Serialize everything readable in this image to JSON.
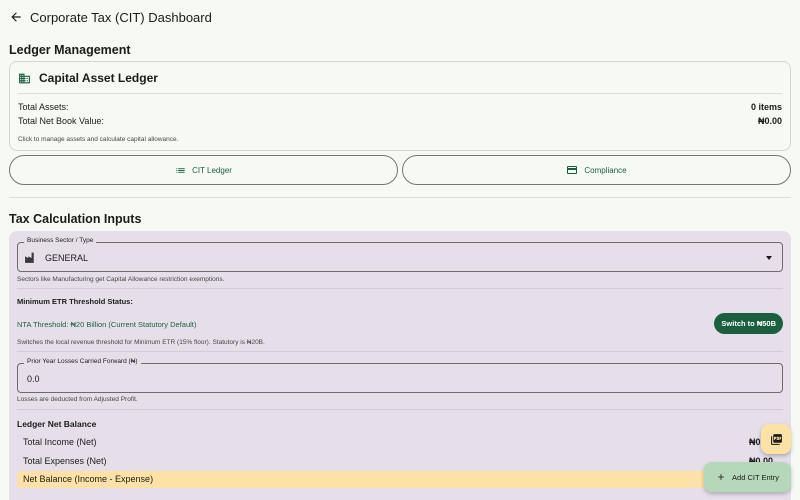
{
  "app": {
    "title": "Corporate Tax (CIT) Dashboard"
  },
  "ledger_management": {
    "heading": "Ledger Management",
    "card": {
      "title": "Capital Asset Ledger",
      "total_assets_label": "Total Assets:",
      "total_assets_value": "0 items",
      "nbv_label": "Total Net Book Value:",
      "nbv_value": "₦0.00",
      "hint": "Click to manage assets and calculate capital allowance."
    },
    "buttons": {
      "cit_ledger": "CIT Ledger",
      "compliance": "Compliance"
    }
  },
  "inputs": {
    "heading": "Tax Calculation Inputs",
    "sector": {
      "label": "Business Sector / Type",
      "value": "GENERAL",
      "hint": "Sectors like Manufacturing get Capital Allowance restriction exemptions."
    },
    "etr": {
      "label": "Minimum ETR Threshold Status:",
      "status": "NTA Threshold: ₦20 Billion (Current Statutory Default)",
      "switch_label": "Switch to ₦50B",
      "hint": "Switches the local revenue threshold for Minimum ETR (15% floor). Statutory is ₦20B."
    },
    "losses": {
      "label": "Prior Year Losses Carried Forward (₦)",
      "value": "0.0",
      "hint": "Losses are deducted from Adjusted Profit."
    },
    "balance": {
      "heading": "Ledger Net Balance",
      "income_label": "Total Income (Net)",
      "income_value": "₦0",
      "expenses_label": "Total Expenses (Net)",
      "expenses_value": "₦0.00",
      "net_label": "Net Balance (Income - Expense)"
    }
  },
  "fab": {
    "label": "Add CIT Entry"
  },
  "colors": {
    "primary": "#1c5f3e",
    "panel": "#e6dfea",
    "highlight": "#fde2a8",
    "fab": "#b5d8bb"
  }
}
